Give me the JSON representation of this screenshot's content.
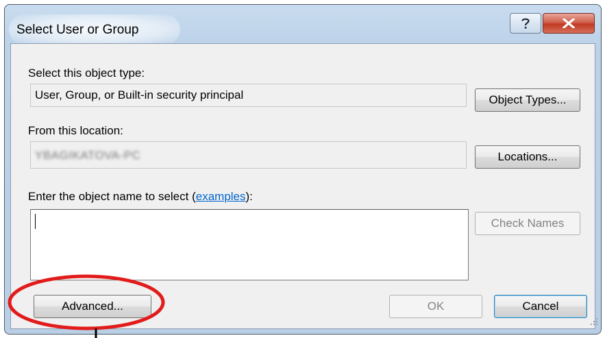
{
  "window": {
    "title": "Select User or Group",
    "help_icon": "help-question-icon",
    "close_icon": "close-x-icon"
  },
  "object_type": {
    "label": "Select this object type:",
    "value": "User, Group, or Built-in security principal",
    "button": "Object Types..."
  },
  "location": {
    "label": "From this location:",
    "value": "YBAGIKATOVA-PC",
    "button": "Locations..."
  },
  "object_name": {
    "label_prefix": "Enter the object name to select (",
    "label_link": "examples",
    "label_suffix": "):",
    "value": "",
    "check_button": "Check Names"
  },
  "footer": {
    "advanced": "Advanced...",
    "ok": "OK",
    "cancel": "Cancel"
  },
  "annotation": {
    "highlight_color": "#e21b1b",
    "target": "Advanced..."
  }
}
